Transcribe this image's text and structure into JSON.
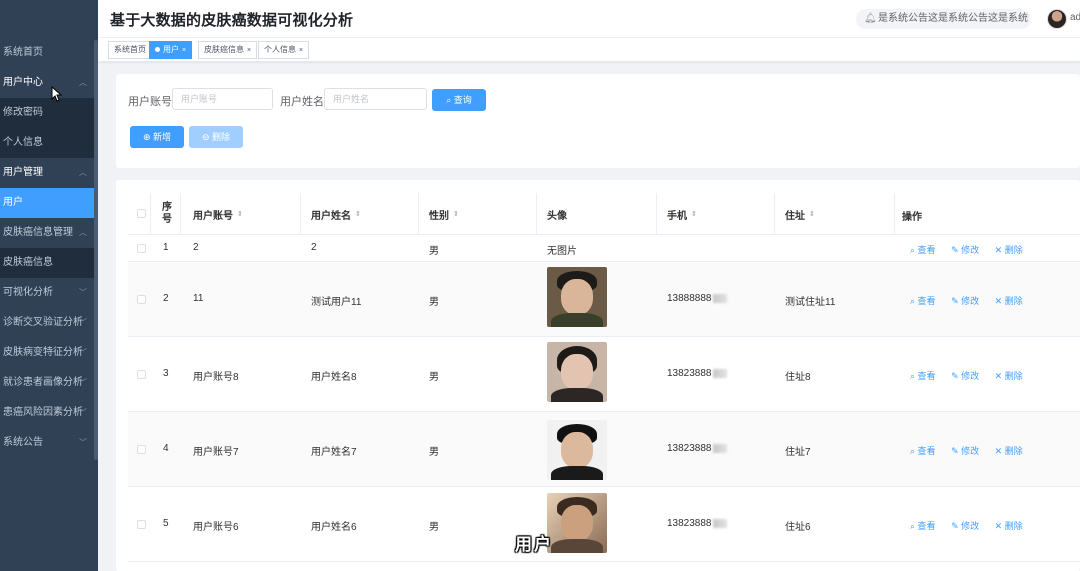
{
  "sidebar": {
    "items": [
      {
        "label": "系统首页"
      },
      {
        "label": "用户中心"
      },
      {
        "label": "修改密码"
      },
      {
        "label": "个人信息"
      },
      {
        "label": "用户管理"
      },
      {
        "label": "用户"
      },
      {
        "label": "皮肤癌信息管理"
      },
      {
        "label": "皮肤癌信息"
      },
      {
        "label": "可视化分析"
      },
      {
        "label": "诊断交叉验证分析"
      },
      {
        "label": "皮肤病变特征分析"
      },
      {
        "label": "就诊患者画像分析"
      },
      {
        "label": "患癌风险因素分析"
      },
      {
        "label": "系统公告"
      }
    ]
  },
  "header": {
    "title": "基于大数据的皮肤癌数据可视化分析",
    "notice": "是系统公告这是系统公告这是系统",
    "user": "ad"
  },
  "tags": [
    {
      "label": "系统首页"
    },
    {
      "label": "用户"
    },
    {
      "label": "皮肤癌信息"
    },
    {
      "label": "个人信息"
    }
  ],
  "search": {
    "account_label": "用户账号",
    "account_placeholder": "用户账号",
    "name_label": "用户姓名",
    "name_placeholder": "用户姓名",
    "query_label": "查询",
    "add_label": "新增",
    "delete_label": "删除"
  },
  "table": {
    "headers": {
      "index": "序号",
      "account": "用户账号",
      "name": "用户姓名",
      "gender": "性别",
      "avatar": "头像",
      "phone": "手机",
      "address": "住址",
      "actions": "操作"
    },
    "actions": {
      "view": "查看",
      "edit": "修改",
      "delete": "删除"
    },
    "rows": [
      {
        "index": "1",
        "account": "2",
        "name": "2",
        "gender": "男",
        "avatar": "无图片",
        "phone": "",
        "address": ""
      },
      {
        "index": "2",
        "account": "11",
        "name": "测试用户11",
        "gender": "男",
        "avatar": "",
        "phone": "13888888",
        "address": "测试住址11"
      },
      {
        "index": "3",
        "account": "用户账号8",
        "name": "用户姓名8",
        "gender": "男",
        "avatar": "",
        "phone": "13823888",
        "address": "住址8"
      },
      {
        "index": "4",
        "account": "用户账号7",
        "name": "用户姓名7",
        "gender": "男",
        "avatar": "",
        "phone": "13823888",
        "address": "住址7"
      },
      {
        "index": "5",
        "account": "用户账号6",
        "name": "用户姓名6",
        "gender": "男",
        "avatar": "",
        "phone": "13823888",
        "address": "住址6"
      }
    ]
  },
  "caption": "用户"
}
